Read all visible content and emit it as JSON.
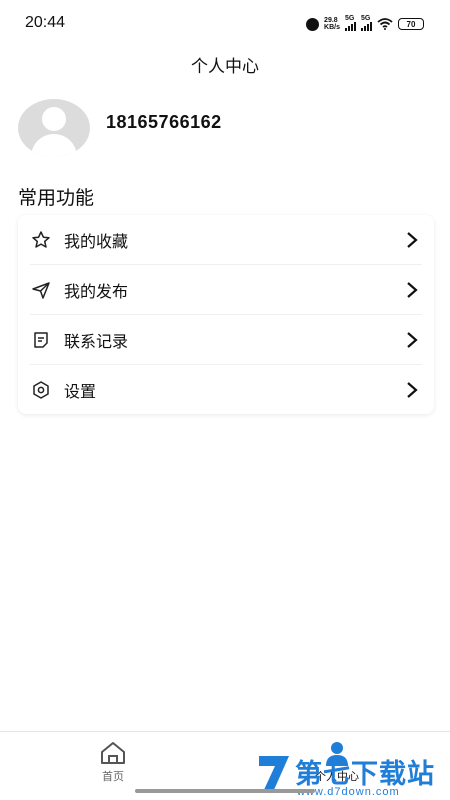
{
  "status": {
    "time": "20:44",
    "net_speed_value": "29.8",
    "net_speed_unit": "KB/s",
    "sim1": "5G",
    "sim2": "5G",
    "battery": "70"
  },
  "header": {
    "title": "个人中心"
  },
  "profile": {
    "phone": "18165766162"
  },
  "section": {
    "title": "常用功能"
  },
  "menu": {
    "items": [
      {
        "label": "我的收藏",
        "icon": "star-icon"
      },
      {
        "label": "我的发布",
        "icon": "send-icon"
      },
      {
        "label": "联系记录",
        "icon": "note-icon"
      },
      {
        "label": "设置",
        "icon": "settings-icon"
      }
    ]
  },
  "tabbar": {
    "items": [
      {
        "label": "首页",
        "icon": "home-icon"
      },
      {
        "label": "个人中心",
        "icon": "person-icon"
      }
    ]
  },
  "watermark": {
    "text": "第七下载站",
    "url": "www.d7down.com"
  },
  "colors": {
    "accent": "#1f7ed8",
    "text": "#111111",
    "muted": "#666666"
  }
}
